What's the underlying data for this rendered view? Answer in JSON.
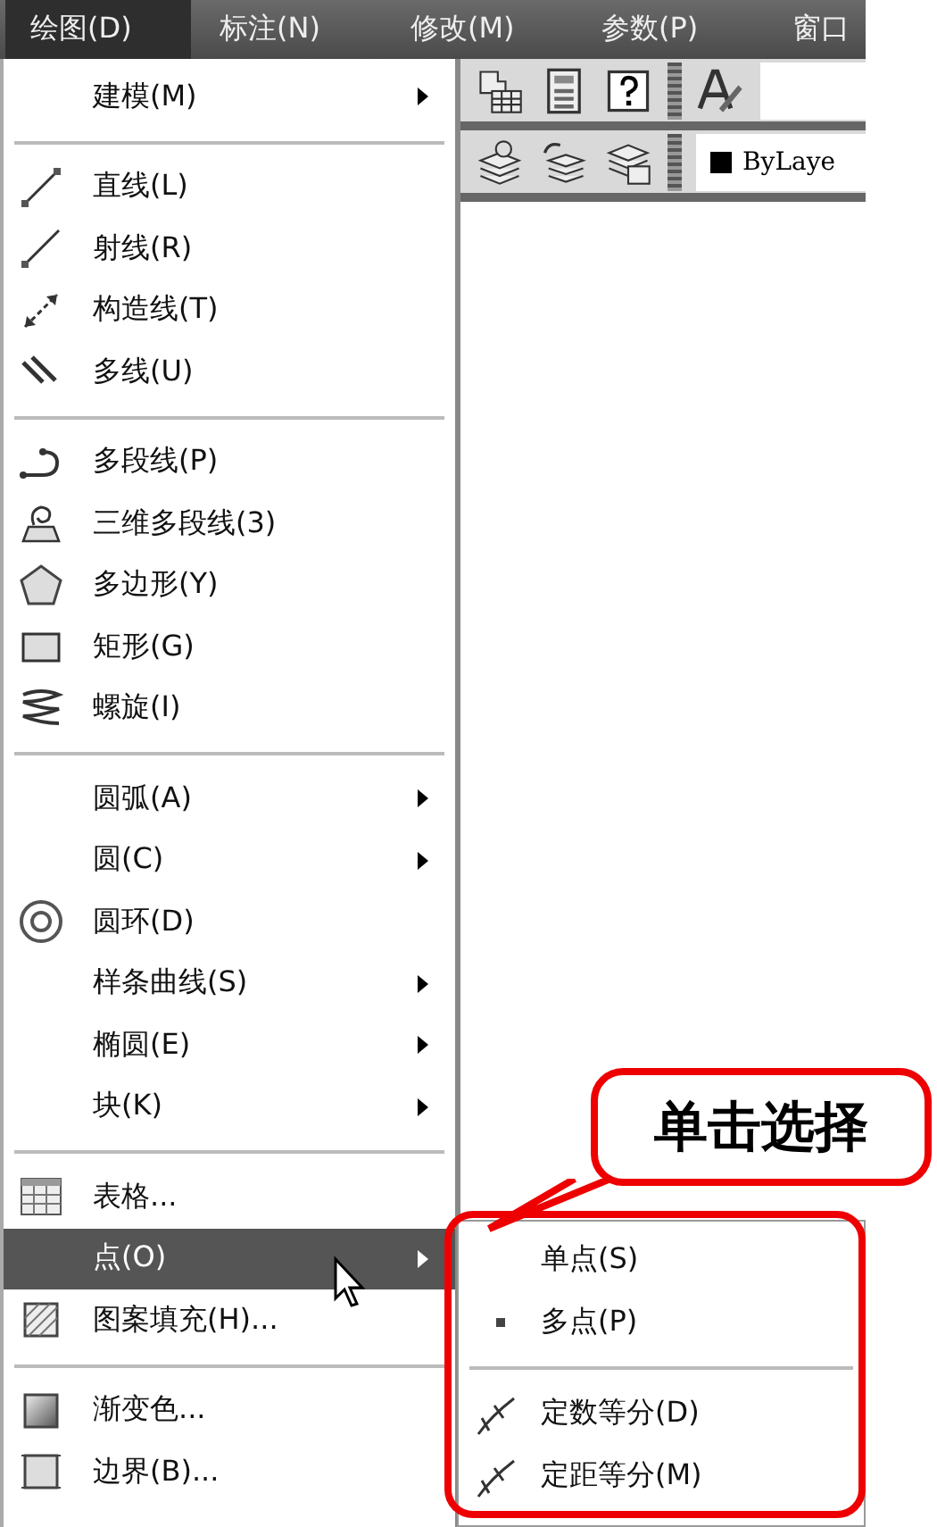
{
  "menu_bar": [
    {
      "label": "绘图(D)",
      "selected": true
    },
    {
      "label": "标注(N)",
      "selected": false
    },
    {
      "label": "修改(M)",
      "selected": false
    },
    {
      "label": "参数(P)",
      "selected": false
    },
    {
      "label": "窗口",
      "selected": false
    }
  ],
  "toolbar": {
    "layer_field": "ByLaye"
  },
  "menu": [
    {
      "kind": "item",
      "label": "建模(M)",
      "submenu": true,
      "selected": false
    },
    {
      "kind": "separator"
    },
    {
      "kind": "item",
      "label": "直线(L)",
      "submenu": false,
      "selected": false
    },
    {
      "kind": "item",
      "label": "射线(R)",
      "submenu": false,
      "selected": false
    },
    {
      "kind": "item",
      "label": "构造线(T)",
      "submenu": false,
      "selected": false
    },
    {
      "kind": "item",
      "label": "多线(U)",
      "submenu": false,
      "selected": false
    },
    {
      "kind": "separator"
    },
    {
      "kind": "item",
      "label": "多段线(P)",
      "submenu": false,
      "selected": false
    },
    {
      "kind": "item",
      "label": "三维多段线(3)",
      "submenu": false,
      "selected": false
    },
    {
      "kind": "item",
      "label": "多边形(Y)",
      "submenu": false,
      "selected": false
    },
    {
      "kind": "item",
      "label": "矩形(G)",
      "submenu": false,
      "selected": false
    },
    {
      "kind": "item",
      "label": "螺旋(I)",
      "submenu": false,
      "selected": false
    },
    {
      "kind": "separator"
    },
    {
      "kind": "item",
      "label": "圆弧(A)",
      "submenu": true,
      "selected": false
    },
    {
      "kind": "item",
      "label": "圆(C)",
      "submenu": true,
      "selected": false
    },
    {
      "kind": "item",
      "label": "圆环(D)",
      "submenu": false,
      "selected": false
    },
    {
      "kind": "item",
      "label": "样条曲线(S)",
      "submenu": true,
      "selected": false
    },
    {
      "kind": "item",
      "label": "椭圆(E)",
      "submenu": true,
      "selected": false
    },
    {
      "kind": "item",
      "label": "块(K)",
      "submenu": true,
      "selected": false
    },
    {
      "kind": "separator"
    },
    {
      "kind": "item",
      "label": "表格...",
      "submenu": false,
      "selected": false
    },
    {
      "kind": "item",
      "label": "点(O)",
      "submenu": true,
      "selected": true
    },
    {
      "kind": "item",
      "label": "图案填充(H)...",
      "submenu": false,
      "selected": false
    },
    {
      "kind": "separator"
    },
    {
      "kind": "item",
      "label": "渐变色...",
      "submenu": false,
      "selected": false
    },
    {
      "kind": "item",
      "label": "边界(B)...",
      "submenu": false,
      "selected": false
    }
  ],
  "submenu": [
    {
      "kind": "item",
      "label": "单点(S)"
    },
    {
      "kind": "item",
      "label": "多点(P)"
    },
    {
      "kind": "separator"
    },
    {
      "kind": "item",
      "label": "定数等分(D)"
    },
    {
      "kind": "item",
      "label": "定距等分(M)"
    }
  ],
  "callout": {
    "text": "单击选择"
  }
}
